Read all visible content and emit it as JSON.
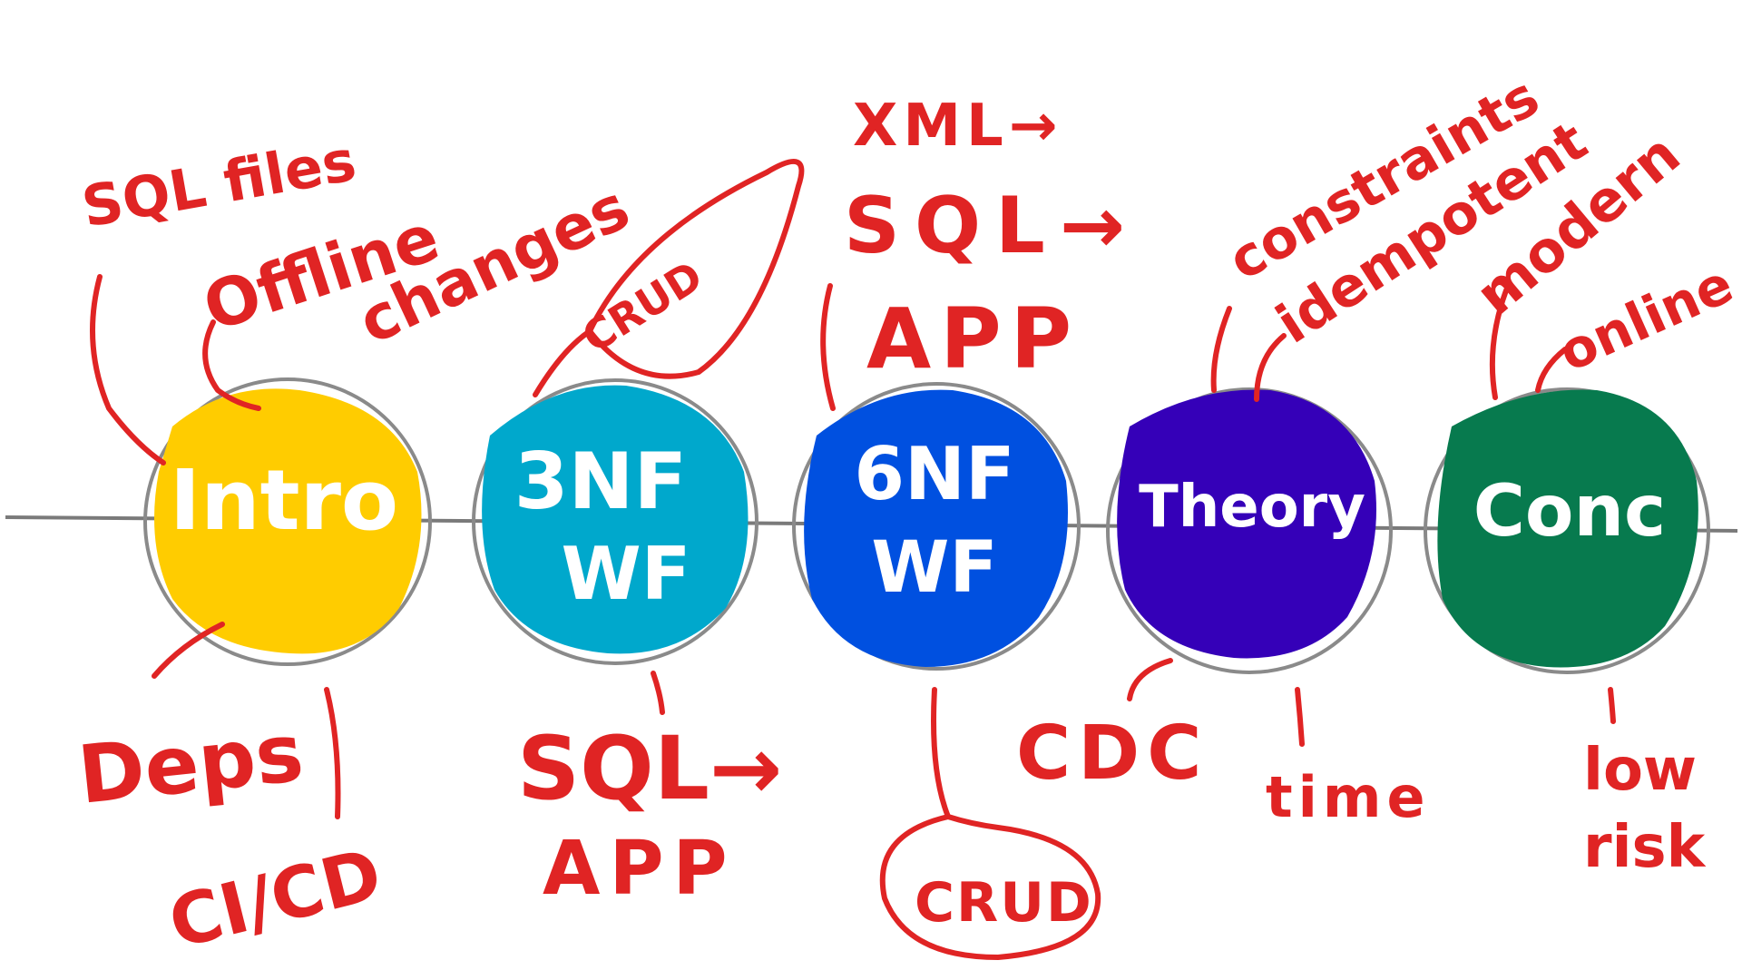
{
  "colors": {
    "ink": "#e02424",
    "timeline": "#7a7a7a",
    "ring": "#8a8a8a"
  },
  "nodes": [
    {
      "id": "intro",
      "label_lines": [
        "Intro"
      ],
      "color": "#ffcc00"
    },
    {
      "id": "3nf",
      "label_lines": [
        "3NF",
        "WF"
      ],
      "color": "#00a8cc"
    },
    {
      "id": "6nf",
      "label_lines": [
        "6NF",
        "WF"
      ],
      "color": "#0050e0"
    },
    {
      "id": "theory",
      "label_lines": [
        "Theory"
      ],
      "color": "#3500b8"
    },
    {
      "id": "conc",
      "label_lines": [
        "Conc"
      ],
      "color": "#077a4e"
    }
  ],
  "notes": {
    "intro_top_1": "SQL files",
    "intro_top_2": "Offline",
    "intro_top_3": "changes",
    "intro_bottom_1": "Deps",
    "intro_bottom_2": "CI/CD",
    "nf3_top": "CRUD",
    "nf3_bottom_1": "SQL→",
    "nf3_bottom_2": "APP",
    "nf6_top_1": "XML→",
    "nf6_top_2": "SQL→",
    "nf6_top_3": "APP",
    "nf6_bottom": "CRUD",
    "theory_top_1": "constraints",
    "theory_top_2": "idempotent",
    "theory_bottom_1": "CDC",
    "theory_bottom_2": "time",
    "conc_top_1": "modern",
    "conc_top_2": "online",
    "conc_bottom_1": "low",
    "conc_bottom_2": "risk"
  }
}
